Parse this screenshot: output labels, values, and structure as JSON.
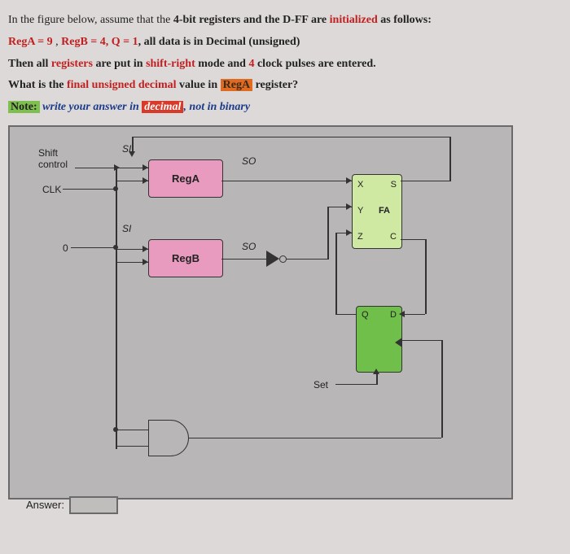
{
  "question": {
    "line1_a": "In the figure below, assume that the ",
    "line1_b": "4-bit registers and the D-FF are ",
    "line1_c": "initialized",
    "line1_d": " as follows:",
    "regA_lbl": "RegA = 9",
    "sep": " ,    ",
    "regB_lbl": "RegB = 4",
    "q_lbl": ",  Q = 1",
    "line2_tail": ",  all data is in Decimal (unsigned)",
    "line3_a": "Then all ",
    "line3_b": "registers",
    "line3_c": " are put in ",
    "line3_d": "shift-right",
    "line3_e": " mode and ",
    "line3_f": "4",
    "line3_g": " clock pulses are entered.",
    "line4_a": "What is the ",
    "line4_b": "final unsigned decimal",
    "line4_c": " value in  ",
    "line4_d": "RegA",
    "line4_e": " register?",
    "note_a": "Note:",
    "note_b": " write your answer in ",
    "note_c": "decimal",
    "note_d": ", not in binary"
  },
  "diagram_labels": {
    "shift_control": "Shift control",
    "clk": "CLK",
    "zero": "0",
    "si": "SI",
    "so": "SO",
    "rega": "RegA",
    "regb": "RegB",
    "x": "X",
    "y": "Y",
    "z": "Z",
    "fa": "FA",
    "s": "S",
    "c": "C",
    "q": "Q",
    "d": "D",
    "set": "Set"
  },
  "answer": {
    "label": "Answer:",
    "value": ""
  }
}
